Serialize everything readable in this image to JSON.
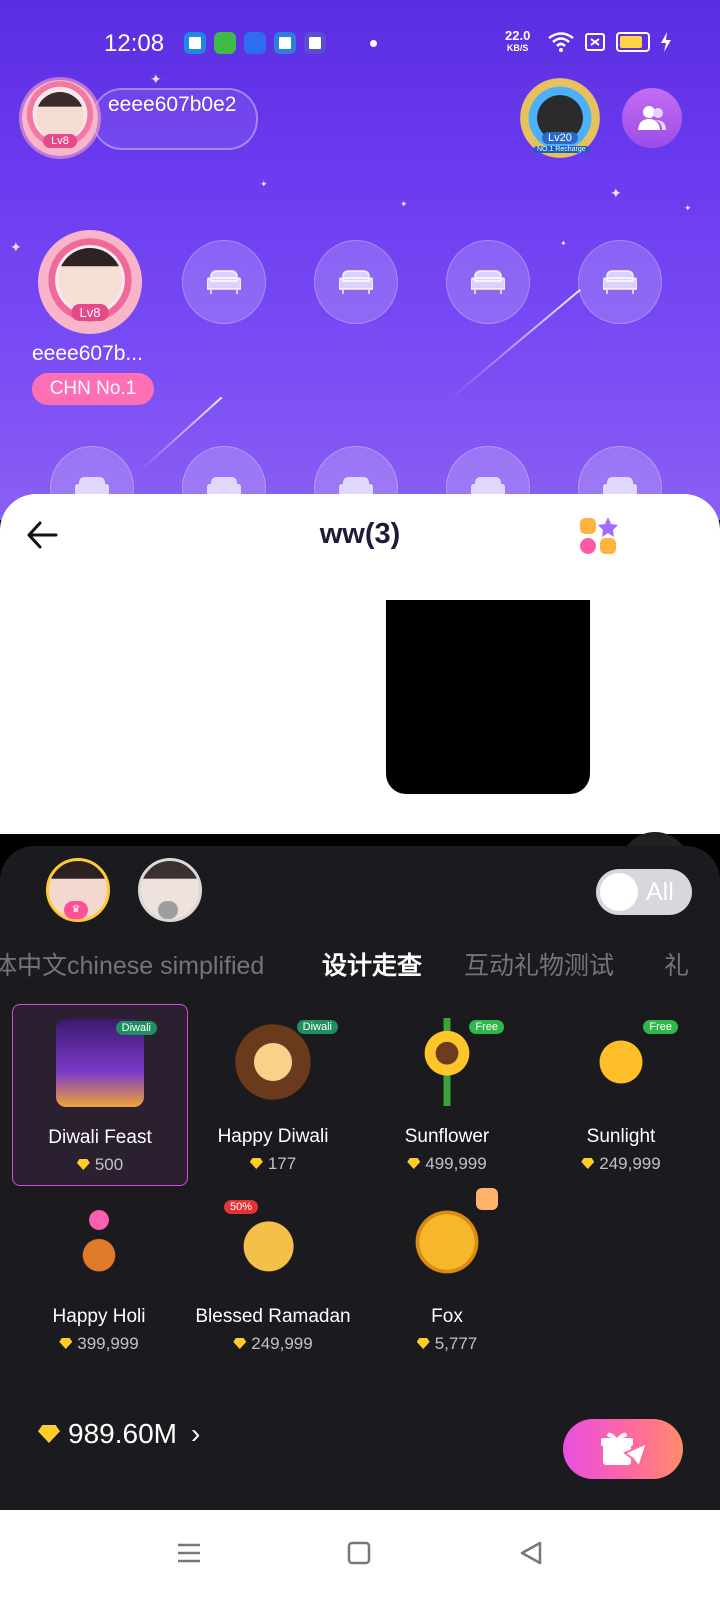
{
  "status_bar": {
    "time": "12:08",
    "net_speed_value": "22.0",
    "net_speed_unit": "KB/S"
  },
  "host": {
    "name": "eeee607b0e2",
    "level": "Lv8"
  },
  "top_rank": {
    "level": "Lv20",
    "label": "NO.1 Recharge"
  },
  "seat_host": {
    "name": "eeee607b...",
    "level": "Lv8",
    "badge": "CHN No.1"
  },
  "sheet": {
    "title": "ww(3)"
  },
  "gift_panel": {
    "all_toggle_label": "All",
    "categories": [
      {
        "label": "体中文chinese simplified"
      },
      {
        "label": "设计走查"
      },
      {
        "label": "互动礼物测试"
      },
      {
        "label": "礼"
      }
    ],
    "active_category": "设计走查",
    "gifts": [
      {
        "name": "Diwali Feast",
        "price": "500",
        "tag": "Diwali"
      },
      {
        "name": "Happy Diwali",
        "price": "177",
        "tag": "Diwali"
      },
      {
        "name": "Sunflower",
        "price": "499,999",
        "tag": "Free"
      },
      {
        "name": "Sunlight",
        "price": "249,999",
        "tag": "Free"
      },
      {
        "name": "Happy Holi",
        "price": "399,999",
        "tag": ""
      },
      {
        "name": "Blessed Ramadan",
        "price": "249,999",
        "tag": "50%"
      },
      {
        "name": "Fox",
        "price": "5,777",
        "tag": ""
      }
    ],
    "balance": "989.60M"
  },
  "colors": {
    "accent_pink": "#ff6fb5",
    "room_bg": "#6b3cf0",
    "panel_bg": "#1b1a1e",
    "gem": "#ffcc2a"
  }
}
